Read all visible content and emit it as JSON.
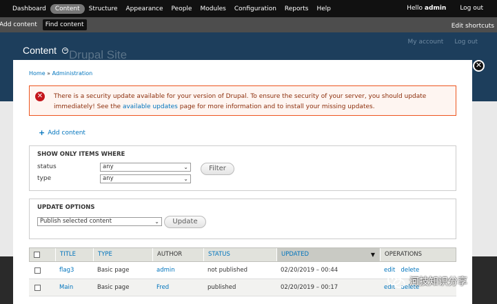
{
  "toolbar": {
    "items": [
      "Dashboard",
      "Content",
      "Structure",
      "Appearance",
      "People",
      "Modules",
      "Configuration",
      "Reports",
      "Help"
    ],
    "active": "Content",
    "greeting": "Hello",
    "username": "admin",
    "logout": "Log out"
  },
  "shortcuts": {
    "add_content": "Add content",
    "find_content": "Find content",
    "edit_shortcuts": "Edit shortcuts"
  },
  "background": {
    "site_name": "Drupal Site",
    "my_account": "My account",
    "log_out": "Log out"
  },
  "overlay": {
    "title": "Content"
  },
  "breadcrumb": {
    "home": "Home",
    "separator": "»",
    "admin": "Administration"
  },
  "alert": {
    "text_before": "There is a security update available for your version of Drupal. To ensure the security of your server, you should update immediately! See the",
    "link": "available updates",
    "text_after": "page for more information and to install your missing updates."
  },
  "add_content": "Add content",
  "filters": {
    "legend": "SHOW ONLY ITEMS WHERE",
    "status_label": "status",
    "status_value": "any",
    "type_label": "type",
    "type_value": "any",
    "filter_button": "Filter"
  },
  "update_options": {
    "legend": "UPDATE OPTIONS",
    "action_value": "Publish selected content",
    "update_button": "Update"
  },
  "table": {
    "headers": {
      "title": "TITLE",
      "type": "TYPE",
      "author": "AUTHOR",
      "status": "STATUS",
      "updated": "UPDATED",
      "operations": "OPERATIONS"
    },
    "rows": [
      {
        "title": "flag3",
        "type": "Basic page",
        "author": "admin",
        "status": "not published",
        "updated": "02/20/2019 – 00:44",
        "edit": "edit",
        "delete": "delete"
      },
      {
        "title": "Main",
        "type": "Basic page",
        "author": "Fred",
        "status": "published",
        "updated": "02/20/2019 – 00:17",
        "edit": "edit",
        "delete": "delete"
      }
    ]
  },
  "watermark": "河技知识分享",
  "colors": {
    "link": "#0074bd",
    "alert_border": "#ed541d",
    "alert_bg": "#fef5f1",
    "error_icon": "#c4161c",
    "toolbar_bg": "#111111"
  }
}
